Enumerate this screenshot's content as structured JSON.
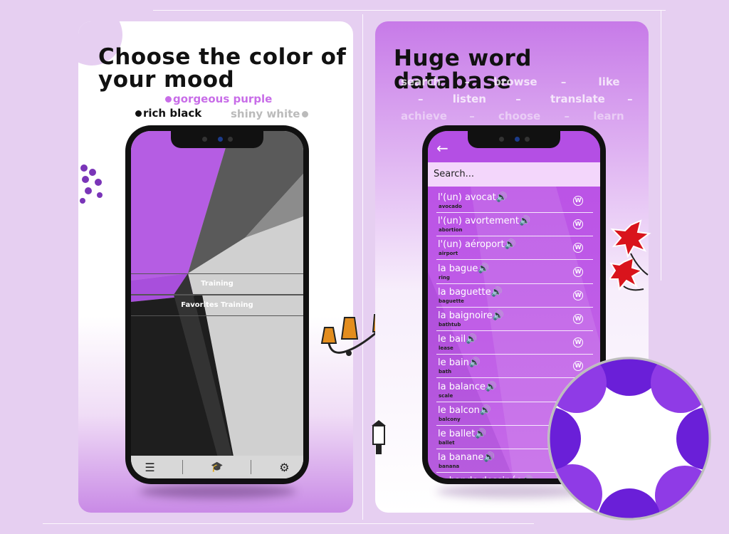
{
  "left_card": {
    "title": "Choose the color of your mood",
    "moods": {
      "purple": "gorgeous purple",
      "black": "rich black",
      "white": "shiny white"
    },
    "colors": {
      "purple": "#c86de8",
      "black": "#111111",
      "white": "#bbbbbb"
    }
  },
  "left_phone": {
    "menu": [
      "Training",
      "Favorites Training"
    ],
    "nav_icons": [
      "menu-icon",
      "graduation-cap-icon",
      "gear-icon"
    ],
    "nav_glyphs": [
      "☰",
      "🎓",
      "⚙"
    ]
  },
  "right_card": {
    "title": "Huge word database",
    "tagline_rows": [
      [
        "search",
        "–",
        "browse",
        "–",
        "like"
      ],
      [
        "–",
        "listen",
        "–",
        "translate",
        "–"
      ],
      [
        "achieve",
        "–",
        "choose",
        "–",
        "learn"
      ]
    ]
  },
  "right_phone": {
    "back_glyph": "←",
    "search_placeholder": "Search...",
    "words": [
      {
        "fr": "l'(un) avocat🔊",
        "en": "avocado"
      },
      {
        "fr": "l'(un) avortement🔊",
        "en": "abortion"
      },
      {
        "fr": "l'(un) aéroport🔊",
        "en": "airport"
      },
      {
        "fr": "la bague🔊",
        "en": "ring"
      },
      {
        "fr": "la baguette🔊",
        "en": "baguette"
      },
      {
        "fr": "la baignoire🔊",
        "en": "bathtub"
      },
      {
        "fr": "le bail🔊",
        "en": "lease"
      },
      {
        "fr": "le bain🔊",
        "en": "bath"
      },
      {
        "fr": "la balance🔊",
        "en": "scale"
      },
      {
        "fr": "le balcon🔊",
        "en": "balcony"
      },
      {
        "fr": "le ballet🔊",
        "en": "ballet"
      },
      {
        "fr": "la banane🔊",
        "en": "banana"
      },
      {
        "fr": "la bande dessinée🔊",
        "en": ""
      }
    ],
    "row_icon": "wordpress-icon",
    "row_icon_glyph": "W"
  },
  "theme": {
    "accent": "#c462ec",
    "logo_dark": "#6a1fd8",
    "logo_mid": "#8f3be6"
  }
}
